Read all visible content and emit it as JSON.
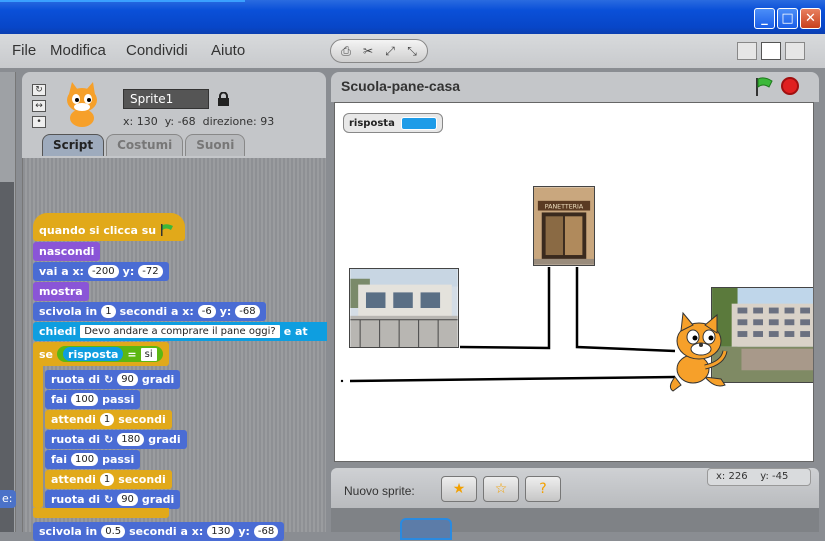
{
  "menu": [
    "File",
    "Modifica",
    "Condividi",
    "Aiuto"
  ],
  "sprite": {
    "name": "Sprite1",
    "x_label": "x:",
    "x": "130",
    "y_label": "y:",
    "y": "-68",
    "dir_label": "direzione:",
    "dir": "93"
  },
  "tabs": [
    "Script",
    "Costumi",
    "Suoni"
  ],
  "stub_text": "e:",
  "script": {
    "when_flag": "quando si clicca su",
    "hide": "nascondi",
    "goto": "vai a x:",
    "goto_x": "-200",
    "goto_y_label": "y:",
    "goto_y": "-72",
    "show": "mostra",
    "glide1": "scivola in",
    "glide1_secs": "1",
    "glide1_mid": "secondi a x:",
    "glide1_x": "-6",
    "glide1_y_label": "y:",
    "glide1_y": "-68",
    "ask": "chiedi",
    "ask_text": "Devo andare a comprare il pane oggi?",
    "ask_tail": "e at",
    "if": "se",
    "answer": "risposta",
    "equals": "=",
    "compare_val": "si",
    "turn": "ruota di",
    "turn1": "90",
    "degrees": "gradi",
    "move": "fai",
    "move1": "100",
    "steps": "passi",
    "wait": "attendi",
    "wait1": "1",
    "seconds": "secondi",
    "turn2": "180",
    "move2": "100",
    "wait2": "1",
    "turn3": "90",
    "glide2": "scivola in",
    "glide2_secs": "0.5",
    "glide2_mid": "secondi a x:",
    "glide2_x": "130",
    "glide2_y_label": "y:",
    "glide2_y": "-68"
  },
  "stage": {
    "title": "Scuola-pane-casa",
    "monitor_label": "risposta",
    "bakery_sign": "PANETTERIA"
  },
  "new_sprite": {
    "label": "Nuovo sprite:"
  },
  "mouse": {
    "x_label": "x:",
    "x": "226",
    "y_label": "y:",
    "y": "-45"
  },
  "colors": {
    "title_bar": "#0a50d8",
    "motion": "#4a6cd4",
    "control": "#e1a91a",
    "looks": "#8a55d7",
    "sensing": "#0e9ee0",
    "operators": "#5cb712"
  },
  "icons": [
    "minimize-icon",
    "maximize-icon",
    "close-icon",
    "green-flag-icon",
    "stop-icon",
    "lock-icon",
    "paint-sprite-icon",
    "folder-sprite-icon",
    "random-sprite-icon"
  ]
}
